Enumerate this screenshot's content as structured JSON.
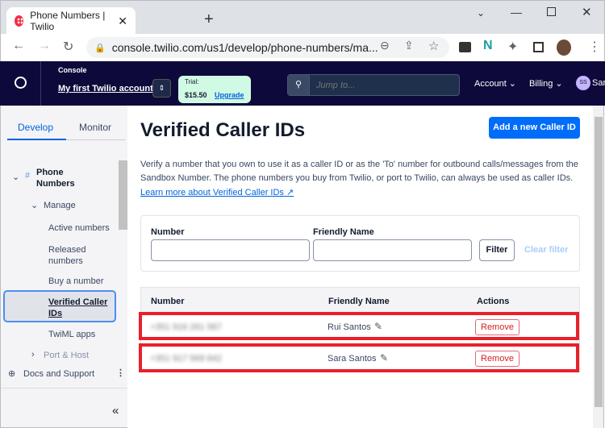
{
  "browser": {
    "tab_title": "Phone Numbers | Twilio",
    "url": "console.twilio.com/us1/develop/phone-numbers/ma..."
  },
  "header": {
    "console_label": "Console",
    "account_name": "My first Twilio account",
    "trial_label": "Trial:",
    "balance": "$15.50",
    "upgrade": "Upgrade",
    "search_placeholder": "Jump to...",
    "account_menu": "Account",
    "billing_menu": "Billing",
    "avatar_initials": "SS",
    "user_name": "Sar"
  },
  "sidebar": {
    "tabs": [
      "Develop",
      "Monitor"
    ],
    "active_tab": "Develop",
    "section": "Phone Numbers",
    "group": "Manage",
    "items": [
      "Active numbers",
      "Released numbers",
      "Buy a number",
      "Verified Caller IDs",
      "TwiML apps"
    ],
    "active_item": "Verified Caller IDs",
    "collapsed_group": "Port & Host",
    "docs": "Docs and Support"
  },
  "main": {
    "title": "Verified Caller IDs",
    "add_button": "Add a new Caller ID",
    "description": "Verify a number that you own to use it as a caller ID or as the 'To' number for outbound calls/messages from the Sandbox Number. The phone numbers you buy from Twilio, or port to Twilio, can always be used as caller IDs.",
    "learn_more": "Learn more about Verified Caller IDs",
    "filter": {
      "number_label": "Number",
      "number_value": "",
      "friendly_label": "Friendly Name",
      "friendly_value": "",
      "filter_button": "Filter",
      "clear_filter": "Clear filter"
    },
    "table": {
      "columns": [
        "Number",
        "Friendly Name",
        "Actions"
      ],
      "rows": [
        {
          "number": "+351 916 261 567",
          "friendly_name": "Rui Santos",
          "action": "Remove"
        },
        {
          "number": "+351 917 569 842",
          "friendly_name": "Sara Santos",
          "action": "Remove"
        }
      ]
    }
  },
  "colors": {
    "brand_navy": "#0d0a3b",
    "primary_blue": "#006dfa",
    "highlight_red": "#e9202a",
    "trial_green": "#d1fae5"
  }
}
